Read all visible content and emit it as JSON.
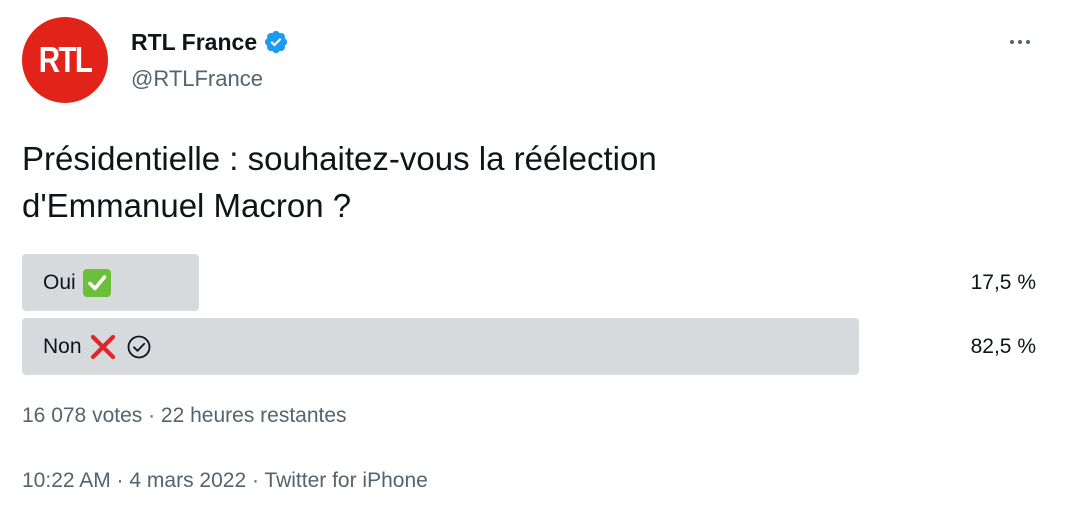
{
  "author": {
    "name": "RTL France",
    "handle": "@RTLFrance",
    "avatar_text": "RTL",
    "avatar_color": "#e2231a",
    "verified": true
  },
  "tweet": {
    "text_line1": "Présidentielle : souhaitez-vous la réélection",
    "text_line2": "d'Emmanuel Macron ?"
  },
  "poll": {
    "options": [
      {
        "label": "Oui",
        "emoji": "white-heavy-check-mark-icon",
        "percent_text": "17,5 %",
        "fraction": 0.175,
        "chosen": false
      },
      {
        "label": "Non",
        "emoji": "cross-mark-icon",
        "percent_text": "82,5 %",
        "fraction": 0.825,
        "chosen": true
      }
    ],
    "summary": "16 078 votes · 22 heures restantes"
  },
  "footer": {
    "timestamp_source": "10:22 AM · 4 mars 2022 · Twitter for iPhone"
  },
  "colors": {
    "bar": "#d6dadd",
    "secondary_text": "#536471",
    "verified_blue": "#1d9bf0"
  }
}
